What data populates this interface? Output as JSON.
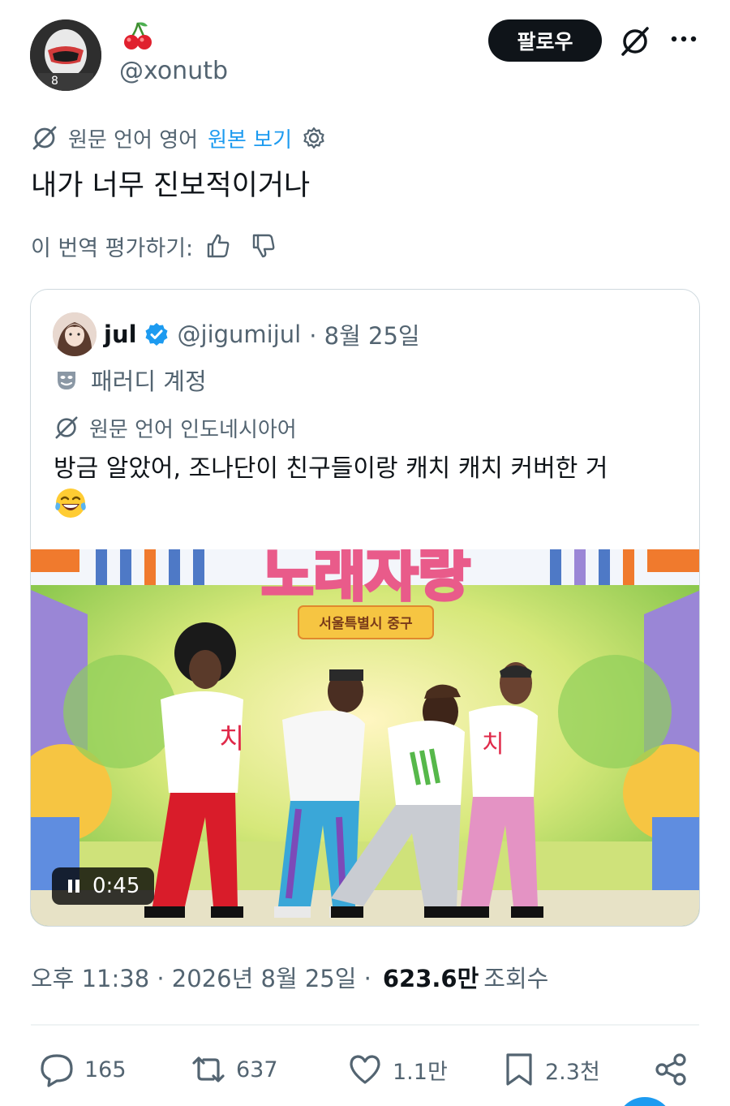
{
  "author": {
    "handle": "@xonutb",
    "name_emoji": "cherry"
  },
  "header": {
    "follow_label": "팔로우"
  },
  "translation": {
    "source_label": "원문 언어 영어",
    "view_original_label": "원본 보기",
    "text": "내가 너무 진보적이거나",
    "rate_label": "이 번역 평가하기:"
  },
  "quote": {
    "name": "jul",
    "handle": "@jigumijul",
    "date_label": "· 8월 25일",
    "parody_label": "패러디 계정",
    "source_label": "원문 언어 인도네시아어",
    "text": "방금 알았어, 조나단이 친구들이랑 캐치 캐치 커버한 거",
    "emoji": "face-with-tears-of-joy",
    "video": {
      "time": "0:45",
      "banner_text": "서울특별시 중구",
      "title_text": "노래자랑",
      "shirt_text": "치"
    }
  },
  "meta": {
    "time": "오후 11:38 · 2026년 8월 25일 ·",
    "views": "623.6만",
    "views_label": "조회수"
  },
  "actions": {
    "replies": "165",
    "reposts": "637",
    "likes": "1.1만",
    "bookmarks": "2.3천"
  },
  "colors": {
    "accent": "#1d9bf0",
    "text": "#0f1419",
    "muted": "#536471",
    "border": "#cfd9de"
  }
}
